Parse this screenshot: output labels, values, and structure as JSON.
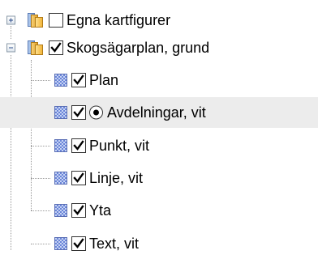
{
  "tree": {
    "groups": [
      {
        "label": "Egna kartfigurer",
        "expanded": false,
        "checked": false,
        "children": []
      },
      {
        "label": "Skogsägarplan, grund",
        "expanded": true,
        "checked": true,
        "children": [
          {
            "label": "Plan",
            "checked": true,
            "active": false
          },
          {
            "label": "Avdelningar, vit",
            "checked": true,
            "active": true
          },
          {
            "label": "Punkt, vit",
            "checked": true,
            "active": false
          },
          {
            "label": "Linje, vit",
            "checked": true,
            "active": false
          },
          {
            "label": "Yta",
            "checked": true,
            "active": false
          },
          {
            "label": "Text, vit",
            "checked": true,
            "active": false
          }
        ]
      }
    ],
    "selected_item": "Avdelningar, vit"
  },
  "colors": {
    "selection_background": "#ececec",
    "expander_border": "#8a9aa8",
    "connector_line": "#9a9a9a",
    "pattern_icon_blue": "#6a85d8"
  },
  "icons": {
    "expand": "plus-expander-icon",
    "collapse": "minus-expander-icon",
    "group_layer": "layer-group-icon",
    "layer": "checker-pattern-layer-icon",
    "active_layer": "radio-selected-icon",
    "check": "checkmark-icon"
  }
}
